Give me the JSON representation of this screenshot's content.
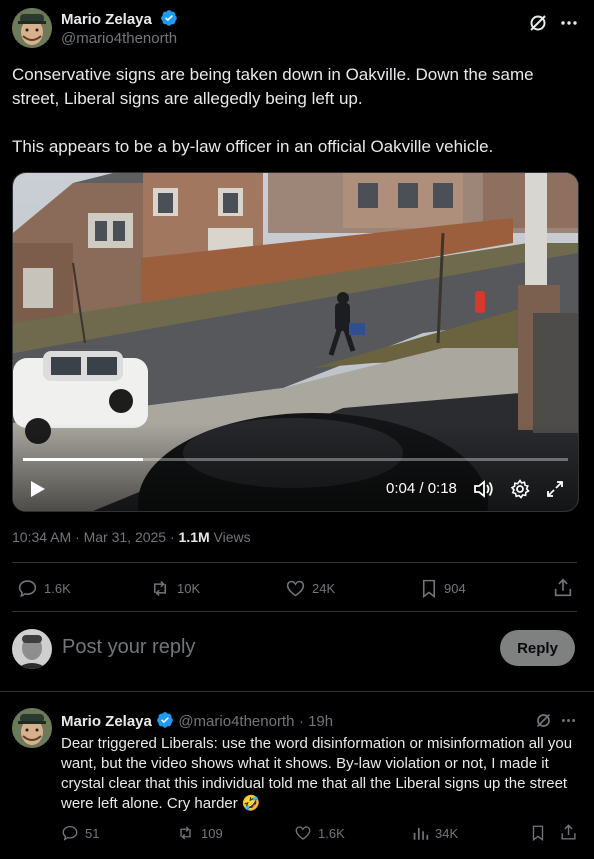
{
  "post": {
    "author_name": "Mario Zelaya",
    "author_handle": "@mario4thenorth",
    "text_para1": "Conservative signs are being taken down in Oakville. Down the same street, Liberal signs are allegedly being left up.",
    "text_para2": "This appears to be a by-law officer in an official Oakville vehicle.",
    "video": {
      "time": "0:04 / 0:18",
      "progress": 0.22
    },
    "timestamp": "10:34 AM · Mar 31, 2025 · ",
    "views_count": "1.1M",
    "views_label": " Views",
    "stats": {
      "replies": "1.6K",
      "reposts": "10K",
      "likes": "24K",
      "bookmarks": "904"
    }
  },
  "composer": {
    "placeholder": "Post your reply",
    "reply_label": "Reply"
  },
  "reply": {
    "author_name": "Mario Zelaya",
    "author_handle": "@mario4thenorth",
    "age": "· 19h",
    "text": "Dear triggered Liberals: use the word disinformation or misinformation all you want, but the video shows what it shows. By-law violation or not, I made it crystal clear that this individual told me that all the Liberal signs up the street were left alone. Cry harder",
    "emoji": "🤣",
    "stats": {
      "replies": "51",
      "reposts": "109",
      "likes": "1.6K",
      "views": "34K"
    }
  },
  "colors": {
    "background": "#000000",
    "text": "#e7e9ea",
    "muted": "#71767b",
    "verified": "#1d9bf0",
    "divider": "#2f3336"
  }
}
